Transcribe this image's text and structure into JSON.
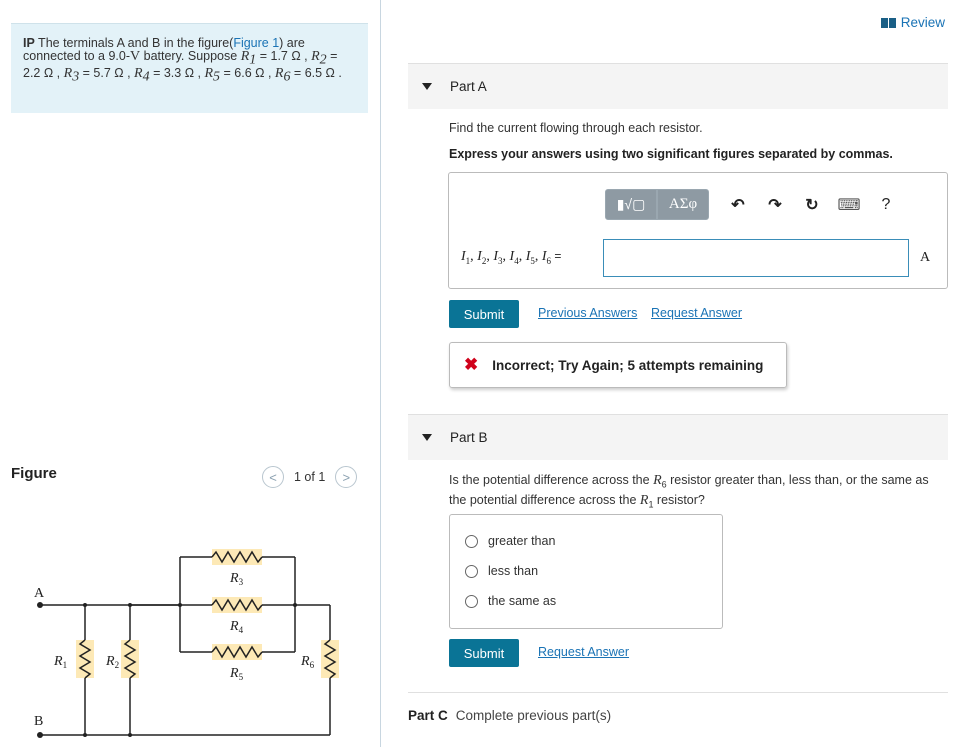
{
  "problem": {
    "ip": "IP",
    "text1": " The terminals A and B in the figure(",
    "figure_link": "Figure 1",
    "text2": ") are connected to a 9.0-",
    "unit_V": "V",
    "text3": " battery. Suppose ",
    "r1": "R",
    "r1_sub": "1",
    "r1_val": " = 1.7 Ω , ",
    "r2": "R",
    "r2_sub": "2",
    "r2_val": " = 2.2 Ω , ",
    "r3": "R",
    "r3_sub": "3",
    "r3_val": " = 5.7 Ω , ",
    "r4": "R",
    "r4_sub": "4",
    "r4_val": " = 3.3 Ω , ",
    "r5": "R",
    "r5_sub": "5",
    "r5_val": " = 6.6 Ω , ",
    "r6": "R",
    "r6_sub": "6",
    "r6_val": " = 6.5 Ω ."
  },
  "figure": {
    "label": "Figure",
    "pager": "1 of 1",
    "prev_glyph": "<",
    "next_glyph": ">",
    "circuit_labels": {
      "a": "A",
      "b": "B",
      "r": "R",
      "r1": "1",
      "r2": "2",
      "r3": "3",
      "r4": "4",
      "r5": "5",
      "r6": "6"
    }
  },
  "review": {
    "label": "Review"
  },
  "partA": {
    "title": "Part A",
    "question": "Find the current flowing through each resistor.",
    "instruction": "Express your answers using two significant figures separated by commas.",
    "toolbar": {
      "templates_glyph": "▮√▢",
      "greek": "ΑΣφ",
      "undo": "↶",
      "redo": "↷",
      "reset": "↻",
      "keyboard": "⌨",
      "help": "?"
    },
    "equation": {
      "i": "I",
      "subs": [
        "1",
        "2",
        "3",
        "4",
        "5",
        "6"
      ],
      "sep": ", ",
      "eq": " ="
    },
    "input_value": "",
    "unit": "A",
    "submit": "Submit",
    "previous_answers": "Previous Answers",
    "request_answer": "Request Answer",
    "feedback": "Incorrect; Try Again; 5 attempts remaining",
    "feedback_icon": "✖"
  },
  "partB": {
    "title": "Part B",
    "q1": "Is the potential difference across the ",
    "r6": "R",
    "r6_sub": "6",
    "q2": " resistor greater than, less than, or the same as the potential difference across the ",
    "r1": "R",
    "r1_sub": "1",
    "q3": " resistor?",
    "options": [
      "greater than",
      "less than",
      "the same as"
    ],
    "submit": "Submit",
    "request_answer": "Request Answer"
  },
  "partC": {
    "title": "Part C",
    "desc": "Complete previous part(s)"
  },
  "colors": {
    "accent": "#0a7496",
    "link": "#1a73b5",
    "problem_bg": "#e3f2f8",
    "error": "#d0021b",
    "resistor_highlight": "#fde9b6"
  }
}
